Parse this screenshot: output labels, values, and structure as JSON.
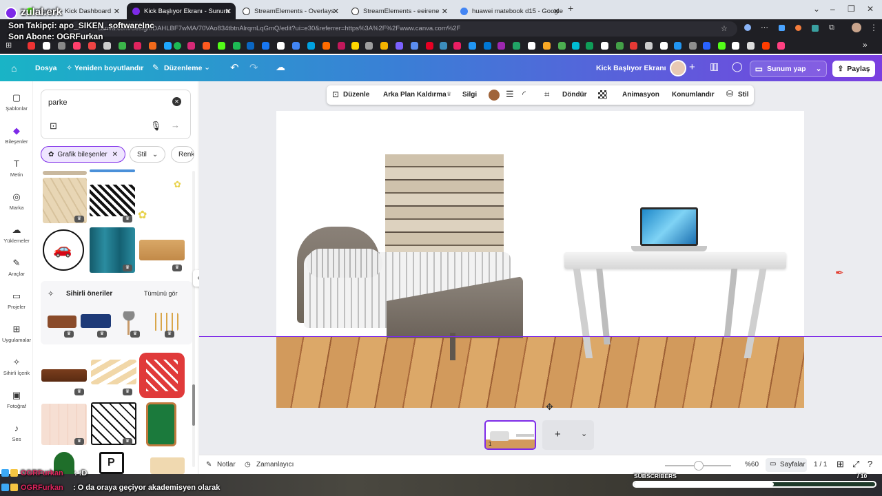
{
  "browser": {
    "tabs": [
      {
        "label": "Stream · Kick Dashboard",
        "fav": "#53fc18"
      },
      {
        "label": "Kick Başlıyor Ekranı - Sunum",
        "fav": "#7d2ae8",
        "active": true
      },
      {
        "label": "StreamElements - Overlays",
        "fav": "#ffffff"
      },
      {
        "label": "StreamElements - eeirene",
        "fav": "#ffffff"
      },
      {
        "label": "huawei matebook d15 - Google",
        "fav": "#4285f4"
      }
    ],
    "url": "canva.com/design/DAHLBF7wMA/70VAo834tbtnAlrqmLqGmQ/edit?ui=e30&referrer=https%3A%2F%2Fwww.canva.com%2F"
  },
  "overlay": {
    "channel": "zulal.erk",
    "last_follower": "Son Takipçi: apo_SIKEN_softwareInc",
    "last_sub": "Son Abone: OGRFurkan",
    "chat1_user": "OGRFurkan",
    "chat1_msg": ": :D",
    "chat2_user": "OGRFurkan",
    "chat2_msg": ": O da oraya geçiyor akademisyen olarak",
    "subs_label": "SUBSCRIBERS",
    "subs_count": "/ 10",
    "subs_progress": 0.58
  },
  "canva": {
    "header": {
      "file": "Dosya",
      "resize": "Yeniden boyutlandır",
      "editing": "Düzenleme",
      "title": "Kick Başlıyor Ekranı",
      "present": "Sunum yap",
      "share": "Paylaş"
    },
    "rail": [
      {
        "label": "Şablonlar",
        "icon": "▢"
      },
      {
        "label": "Bileşenler",
        "icon": "◆"
      },
      {
        "label": "Metin",
        "icon": "T"
      },
      {
        "label": "Marka",
        "icon": "◎"
      },
      {
        "label": "Yüklemeler",
        "icon": "☁"
      },
      {
        "label": "Araçlar",
        "icon": "✎"
      },
      {
        "label": "Projeler",
        "icon": "▭"
      },
      {
        "label": "Uygulamalar",
        "icon": "⊞"
      },
      {
        "label": "Sihirli İçerik",
        "icon": "✧"
      },
      {
        "label": "Fotoğraf",
        "icon": "▣"
      },
      {
        "label": "Ses",
        "icon": "♪"
      }
    ],
    "panel": {
      "search_value": "parke",
      "chip_elements": "Grafik bileşenler",
      "chip_style": "Stil",
      "chip_color": "Renk",
      "magic_title": "Sihirli öneriler",
      "magic_see_all": "Tümünü gör"
    },
    "toolbar": {
      "edit": "Düzenle",
      "bg_remove": "Arka Plan Kaldırma",
      "eraser": "Silgi",
      "color": "#a0643a",
      "rotate": "Döndür",
      "animate": "Animasyon",
      "position": "Konumlandır",
      "style": "Stil"
    },
    "bottom": {
      "notes": "Notlar",
      "timer": "Zamanlayıcı",
      "zoom": "%60",
      "pages": "Sayfalar",
      "page_count": "1 / 1"
    },
    "page_thumb_number": "1"
  }
}
